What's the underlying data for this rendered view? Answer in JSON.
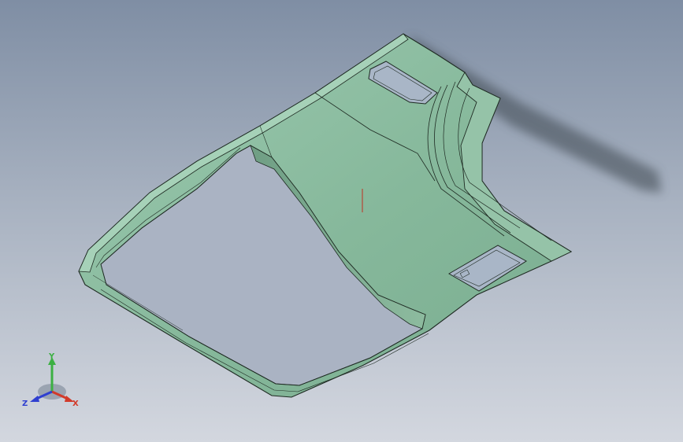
{
  "viewport": {
    "background_top": "#7f8ea4",
    "background_bottom": "#d3d7df"
  },
  "model": {
    "part_type": "roof-headliner-panel",
    "face_color": "#8fbfa3",
    "edge_color": "#1e2a22"
  },
  "triad": {
    "x_label": "X",
    "y_label": "Y",
    "z_label": "Z",
    "x_color": "#d23a2a",
    "y_color": "#3cb043",
    "z_color": "#2f3fd0"
  }
}
